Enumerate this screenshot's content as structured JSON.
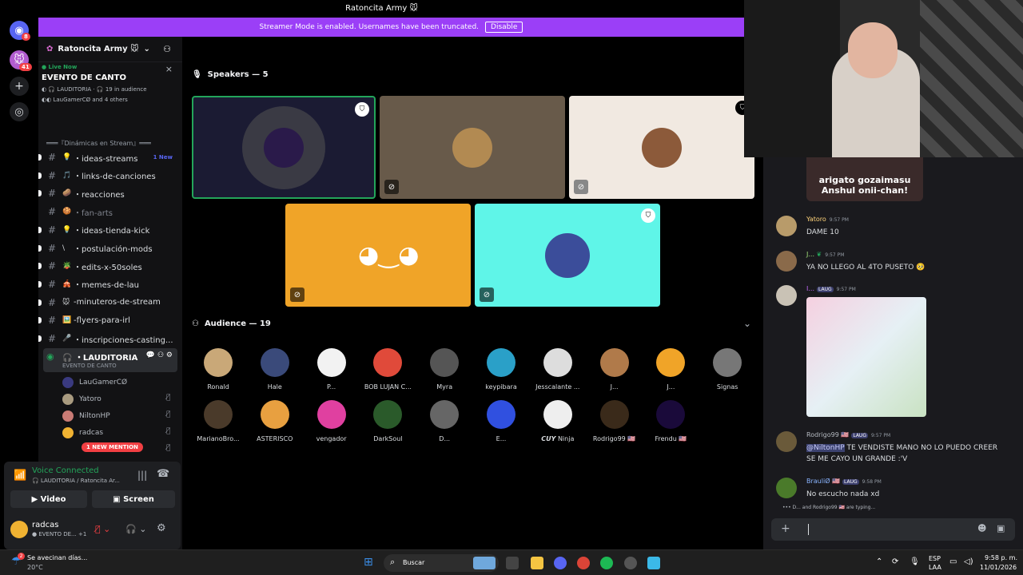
{
  "window": {
    "title": "Ratoncita Army 🐭"
  },
  "rail": {
    "dm_badge": "8",
    "server_badge": "41"
  },
  "banner": {
    "text": "Streamer Mode is enabled. Usernames have been truncated.",
    "disable_label": "Disable"
  },
  "server": {
    "name": "Ratoncita Army 🐭"
  },
  "stage_card": {
    "live": "Live Now",
    "title": "EVENTO DE CANTO",
    "meta": "LAUDITORIA · 🎧 19 in audience",
    "speakers": "LauGamerCØ and 4 others"
  },
  "category": "═══『Dinámicas en Stream』═══",
  "channels": [
    {
      "emoji": "💡",
      "label": "・ideas-streams",
      "new": "1 New"
    },
    {
      "emoji": "🎵",
      "label": "・links-de-canciones"
    },
    {
      "emoji": "🥔",
      "label": "・reacciones"
    },
    {
      "emoji": "🍪",
      "label": "・fan-arts"
    },
    {
      "emoji": "💡",
      "label": "・ideas-tienda-kick"
    },
    {
      "emoji": "\\",
      "label": "・postulación-mods"
    },
    {
      "emoji": "🪴",
      "label": "・edits-x-50soles"
    },
    {
      "emoji": "🎪",
      "label": "・memes-de-lau"
    },
    {
      "emoji": "🐭",
      "label": "-minuteros-de-stream"
    },
    {
      "emoji": "🖼️",
      "label": "-flyers-para-irl"
    },
    {
      "emoji": "🎤",
      "label": "・inscripciones-casting..."
    }
  ],
  "voice_channel": {
    "name": "・LAUDITORIA",
    "sub": "EVENTO DE CANTO"
  },
  "voice_users": [
    "LauGamerCØ",
    "Yatoro",
    "NiltonHP",
    "radcas"
  ],
  "mention_pill": "1 NEW MENTION",
  "voice_panel": {
    "status": "Voice Connected",
    "location": "LAUDITORIA / Ratoncita Ar...",
    "video": "Video",
    "screen": "Screen",
    "user": "radcas",
    "user_status": "EVENTO DE...",
    "plus": "+1"
  },
  "stage": {
    "speakers_title": "Speakers — 5",
    "audience_title": "Audience — 19"
  },
  "audience": [
    "Ronald",
    "Hale",
    "P...",
    "BOB LUJAN C...",
    "Myra",
    "keypibara",
    "Jesscalante ...",
    "J...",
    "J...",
    "Signas",
    "MarianoBro...",
    "ASTERISCO",
    "vengador",
    "DarkSoul",
    "D...",
    "E...",
    "𝘾𝙐𝙔 Ninja",
    "Rodrigo99 🇺🇸",
    "Frendu 🇺🇸"
  ],
  "chat": {
    "caption_line1": "arigato gozaimasu",
    "caption_line2": "Anshul onii-chan!",
    "messages": [
      {
        "name": "Yatoro",
        "color": "#ffd37a",
        "time": "9:57 PM",
        "text": "DAME 10"
      },
      {
        "name": "J...",
        "color": "#a3e37a",
        "time": "9:57 PM",
        "text": "YA NO LLEGO AL 4TO PUSETO 🥺"
      },
      {
        "name": "I...",
        "color": "#c76bff",
        "time": "9:57 PM",
        "tag": "LAUG",
        "text": ""
      },
      {
        "name": "Rodrigo99 🇺🇸",
        "color": "#b5bac1",
        "time": "9:57 PM",
        "tag": "LAUG",
        "mention": "@NiltonHP",
        "text": " TE VENDISTE MANO NO LO PUEDO CREER SE ME CAYO UN GRANDE :'V"
      },
      {
        "name": "BrauliØ 🇺🇸",
        "color": "#8ab4ff",
        "time": "9:58 PM",
        "tag": "LAUG",
        "text": "No escucho nada xd"
      }
    ],
    "typing": "D... and Rodrigo99 🇺🇸 are typing..."
  },
  "taskbar": {
    "weather": "Se avecinan días...",
    "temp": "20°C",
    "search": "Buscar",
    "lang1": "ESP",
    "lang2": "LAA",
    "time": "9:58 p. m.",
    "date": "11/01/2026"
  }
}
